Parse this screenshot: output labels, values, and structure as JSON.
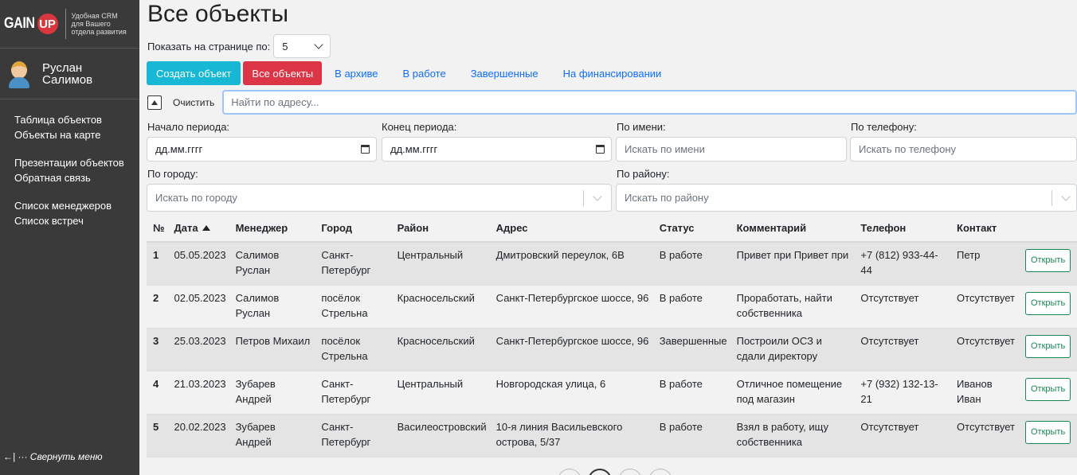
{
  "brand": {
    "logo_gain": "GAIN",
    "logo_up": "UP",
    "tagline": "Удобная CRM для Вашего отдела развития"
  },
  "user": {
    "first_name": "Руслан",
    "last_name": "Салимов"
  },
  "sidebar": {
    "groups": [
      [
        "Таблица объектов",
        "Объекты на карте"
      ],
      [
        "Презентации объектов",
        "Обратная связь"
      ],
      [
        "Список менеджеров",
        "Список встреч"
      ]
    ],
    "collapse_label": "←| ··· Свернуть меню"
  },
  "header": {
    "title": "Все объекты",
    "per_page_label": "Показать на странице по:",
    "per_page_value": "5"
  },
  "tabs": {
    "create": "Создать объект",
    "all": "Все объекты",
    "archive": "В архиве",
    "in_work": "В работе",
    "completed": "Завершенные",
    "financing": "На финансировании"
  },
  "search": {
    "clear_label": "Очистить",
    "address_placeholder": "Найти по адресу..."
  },
  "filters": {
    "start_label": "Начало периода:",
    "start_value": "дд.мм.гггг",
    "end_label": "Конец периода:",
    "end_value": "дд.мм.гггг",
    "name_label": "По имени:",
    "name_placeholder": "Искать по имени",
    "phone_label": "По телефону:",
    "phone_placeholder": "Искать по телефону",
    "city_label": "По городу:",
    "city_placeholder": "Искать по городу",
    "district_label": "По району:",
    "district_placeholder": "Искать по району"
  },
  "table": {
    "headers": [
      "№",
      "Дата",
      "Менеджер",
      "Город",
      "Район",
      "Адрес",
      "Статус",
      "Комментарий",
      "Телефон",
      "Контакт",
      ""
    ],
    "open_label": "Открыть",
    "rows": [
      [
        "1",
        "05.05.2023",
        "Салимов Руслан",
        "Санкт-Петербург",
        "Центральный",
        "Дмитровский переулок, 6В",
        "В работе",
        "Привет при Привет при",
        "+7 (812) 933-44-44",
        "Петр"
      ],
      [
        "2",
        "02.05.2023",
        "Салимов Руслан",
        "посёлок Стрельна",
        "Красносельский",
        "Санкт-Петербургское шоссе, 96",
        "В работе",
        "Проработать, найти собственника",
        "Отсутствует",
        "Отсутствует"
      ],
      [
        "3",
        "25.03.2023",
        "Петров Михаил",
        "посёлок Стрельна",
        "Красносельский",
        "Санкт-Петербургское шоссе, 96",
        "Завершенные",
        "Построили ОСЗ и сдали директору",
        "Отсутствует",
        "Отсутствует"
      ],
      [
        "4",
        "21.03.2023",
        "Зубарев Андрей",
        "Санкт-Петербург",
        "Центральный",
        "Новгородская улица, 6",
        "В работе",
        "Отличное помещение под магазин",
        "+7 (932) 132-13-21",
        "Иванов Иван"
      ],
      [
        "5",
        "20.02.2023",
        "Зубарев Андрей",
        "Санкт-Петербург",
        "Василеостровский",
        "10-я линия Васильевского острова, 5/37",
        "В работе",
        "Взял в работу, ищу собственника",
        "Отсутствует",
        "Отсутствует"
      ]
    ]
  },
  "colors": {
    "sidebar_bg": "#3a3a3a",
    "create_btn": "#17b8d6",
    "all_btn": "#dc3545",
    "link": "#0d6efd",
    "open_btn": "#198754"
  }
}
